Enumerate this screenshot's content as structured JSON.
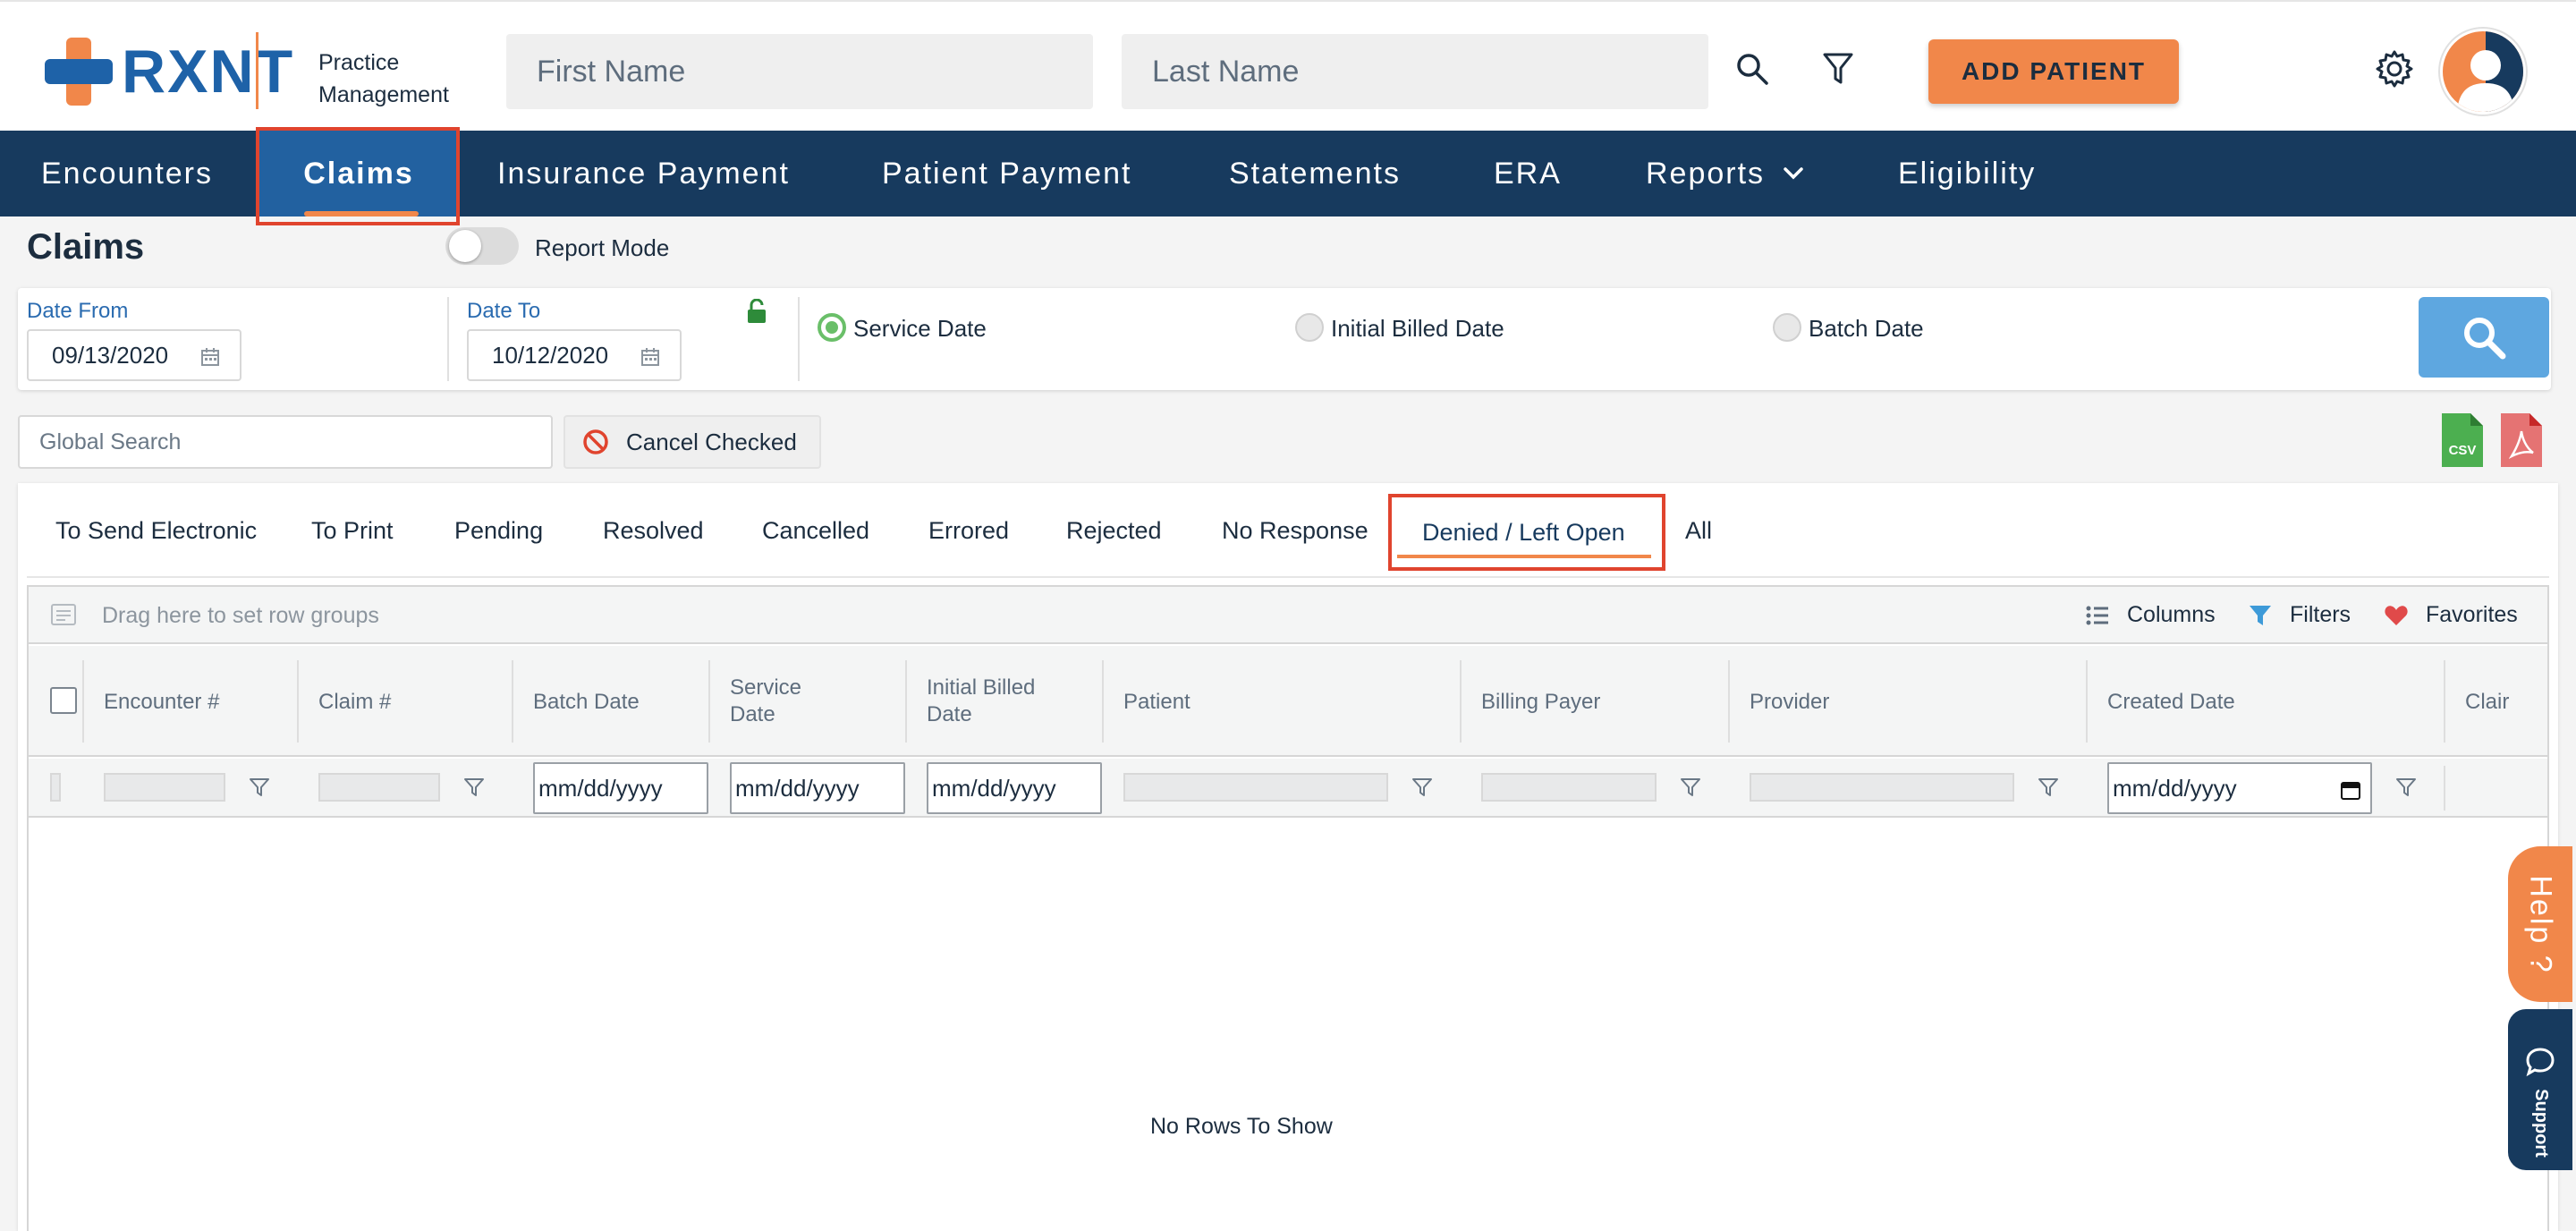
{
  "brand": {
    "logo_text": "RXNT",
    "subtitle_line1": "Practice",
    "subtitle_line2": "Management"
  },
  "header": {
    "first_name_placeholder": "First Name",
    "last_name_placeholder": "Last Name",
    "add_patient_label": "ADD PATIENT"
  },
  "nav": {
    "items": [
      {
        "label": "Encounters"
      },
      {
        "label": "Claims"
      },
      {
        "label": "Insurance Payment"
      },
      {
        "label": "Patient Payment"
      },
      {
        "label": "Statements"
      },
      {
        "label": "ERA"
      },
      {
        "label": "Reports"
      },
      {
        "label": "Eligibility"
      }
    ],
    "active": "Claims"
  },
  "page": {
    "title": "Claims",
    "report_mode_label": "Report Mode",
    "report_mode_on": false
  },
  "filters": {
    "date_from_label": "Date From",
    "date_from_value": "09/13/2020",
    "date_to_label": "Date To",
    "date_to_value": "10/12/2020",
    "radios": [
      {
        "label": "Service Date",
        "selected": true
      },
      {
        "label": "Initial Billed Date",
        "selected": false
      },
      {
        "label": "Batch Date",
        "selected": false
      }
    ]
  },
  "actions": {
    "global_search_placeholder": "Global Search",
    "cancel_checked_label": "Cancel Checked",
    "csv_label": "CSV"
  },
  "tabs": {
    "items": [
      {
        "label": "To Send Electronic"
      },
      {
        "label": "To Print"
      },
      {
        "label": "Pending"
      },
      {
        "label": "Resolved"
      },
      {
        "label": "Cancelled"
      },
      {
        "label": "Errored"
      },
      {
        "label": "Rejected"
      },
      {
        "label": "No Response"
      },
      {
        "label": "Denied / Left Open"
      },
      {
        "label": "All"
      }
    ],
    "active": "Denied / Left Open"
  },
  "grid": {
    "group_placeholder": "Drag here to set row groups",
    "tools": {
      "columns": "Columns",
      "filters": "Filters",
      "favorites": "Favorites"
    },
    "columns": [
      {
        "label": "Encounter #"
      },
      {
        "label": "Claim #"
      },
      {
        "label": "Batch Date"
      },
      {
        "label_line1": "Service",
        "label_line2": "Date"
      },
      {
        "label_line1": "Initial Billed",
        "label_line2": "Date"
      },
      {
        "label": "Patient"
      },
      {
        "label": "Billing Payer"
      },
      {
        "label": "Provider"
      },
      {
        "label": "Created Date"
      },
      {
        "label": "Clair"
      }
    ],
    "date_placeholder": "mm/dd/yyyy",
    "empty_message": "No Rows To Show"
  },
  "widgets": {
    "help_label": "Help ?",
    "support_label": "Support"
  },
  "colors": {
    "navy": "#173a5e",
    "active_nav": "#2261a0",
    "accent_orange": "#f1874a",
    "brand_blue": "#1e62a8",
    "highlight_red": "#e0442e",
    "search_blue": "#5ea7e0",
    "radio_green": "#6abf69"
  }
}
